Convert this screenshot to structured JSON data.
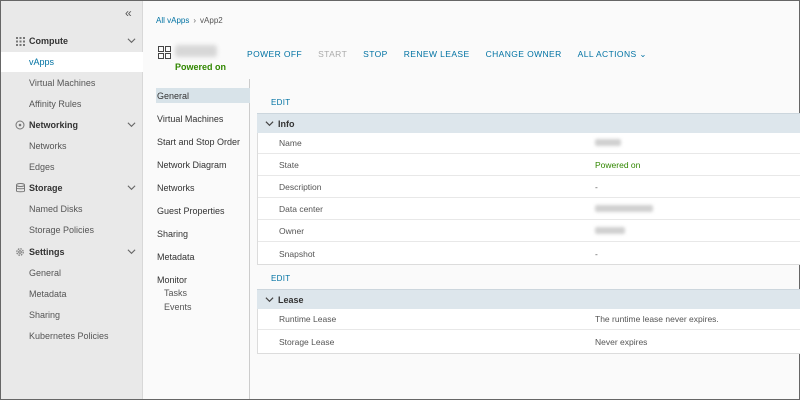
{
  "sidebar": {
    "sections": [
      {
        "label": "Compute",
        "icon": "grid-icon",
        "items": [
          "vApps",
          "Virtual Machines",
          "Affinity Rules"
        ]
      },
      {
        "label": "Networking",
        "icon": "network-icon",
        "items": [
          "Networks",
          "Edges"
        ]
      },
      {
        "label": "Storage",
        "icon": "storage-icon",
        "items": [
          "Named Disks",
          "Storage Policies"
        ]
      },
      {
        "label": "Settings",
        "icon": "gear-icon",
        "items": [
          "General",
          "Metadata",
          "Sharing",
          "Kubernetes Policies"
        ]
      }
    ],
    "active_item": "vApps"
  },
  "breadcrumb": {
    "root": "All vApps",
    "current": "vApp2"
  },
  "vapp": {
    "status": "Powered on"
  },
  "actions": [
    {
      "label": "POWER OFF",
      "enabled": true
    },
    {
      "label": "START",
      "enabled": false
    },
    {
      "label": "STOP",
      "enabled": true
    },
    {
      "label": "RENEW LEASE",
      "enabled": true
    },
    {
      "label": "CHANGE OWNER",
      "enabled": true
    },
    {
      "label": "ALL ACTIONS",
      "enabled": true
    }
  ],
  "tabs": [
    "General",
    "Virtual Machines",
    "Start and Stop Order",
    "Network Diagram",
    "Networks",
    "Guest Properties",
    "Sharing",
    "Metadata",
    "Monitor"
  ],
  "monitor_sub": [
    "Tasks",
    "Events"
  ],
  "edit_label": "EDIT",
  "info": {
    "title": "Info",
    "rows": [
      {
        "key": "Name",
        "value": ""
      },
      {
        "key": "State",
        "value": "Powered on"
      },
      {
        "key": "Description",
        "value": "-"
      },
      {
        "key": "Data center",
        "value": ""
      },
      {
        "key": "Owner",
        "value": ""
      },
      {
        "key": "Snapshot",
        "value": "-"
      }
    ]
  },
  "lease": {
    "title": "Lease",
    "rows": [
      {
        "key": "Runtime Lease",
        "value": "The runtime lease never expires."
      },
      {
        "key": "Storage Lease",
        "value": "Never expires"
      }
    ]
  },
  "colors": {
    "accent": "#0072a3",
    "ok": "#318700"
  }
}
